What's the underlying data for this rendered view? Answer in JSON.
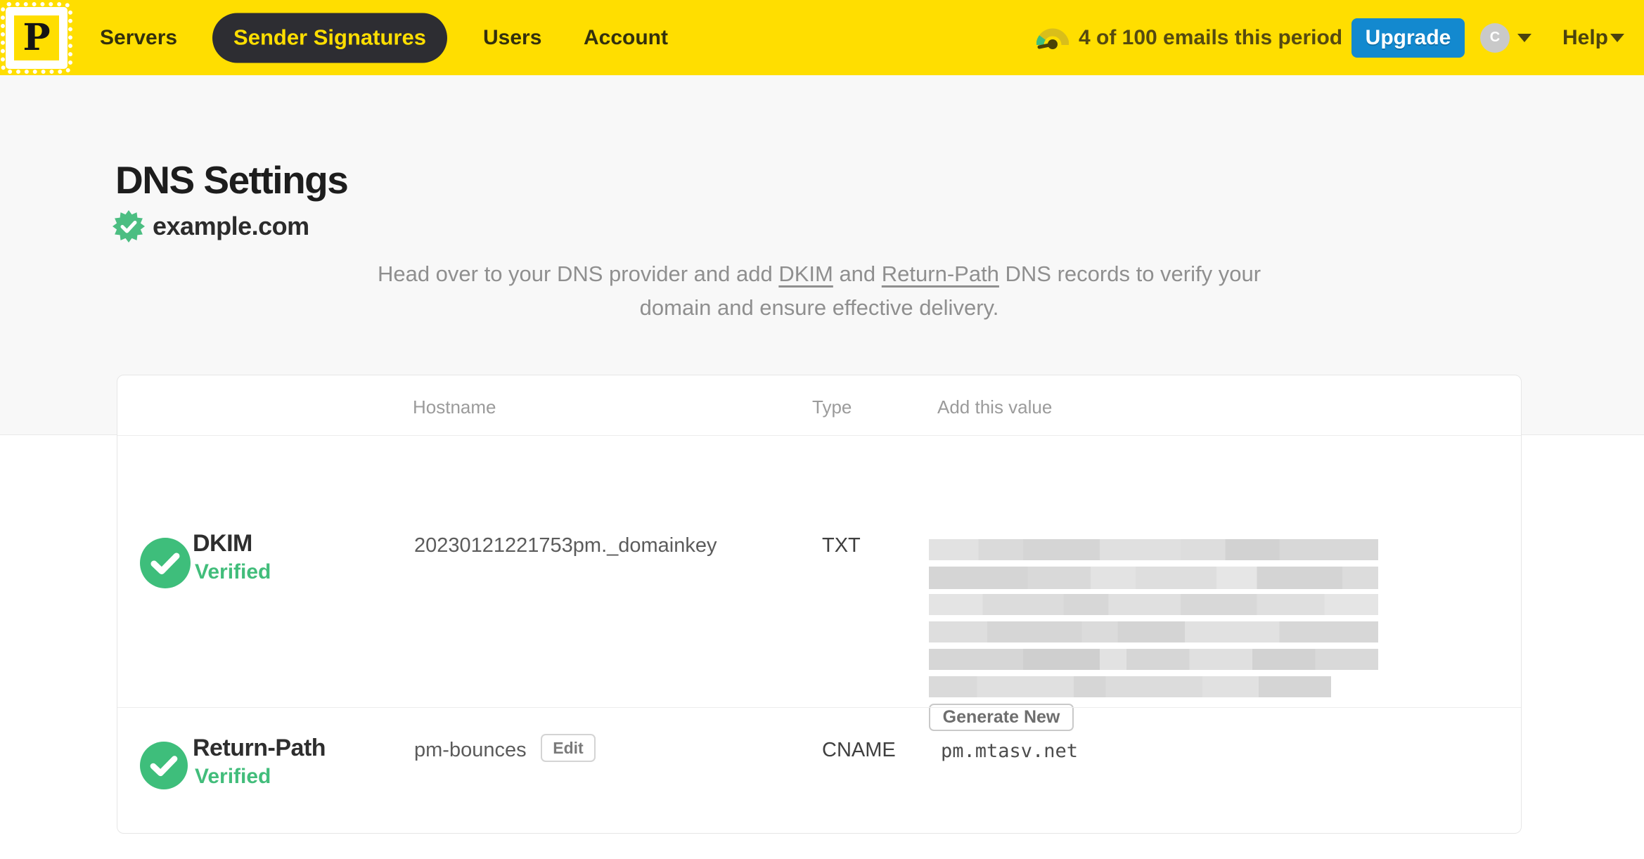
{
  "colors": {
    "brand_yellow": "#FFDE00",
    "nav_pill_dark": "#2D2D32",
    "upgrade_blue": "#1389CF",
    "verified_green": "#3EBE7B",
    "top_section_bg": "#F8F8F8"
  },
  "topbar": {
    "logo_letter": "P",
    "nav": [
      {
        "label": "Servers",
        "active": false
      },
      {
        "label": "Sender Signatures",
        "active": true
      },
      {
        "label": "Users",
        "active": false
      },
      {
        "label": "Account",
        "active": false
      }
    ],
    "usage_text": "4 of 100 emails this period",
    "upgrade_label": "Upgrade",
    "avatar_initial": "C",
    "help_label": "Help"
  },
  "page": {
    "title": "DNS Settings",
    "domain": "example.com",
    "description": {
      "prefix": "Head over to your DNS provider and add ",
      "link_dkim": "DKIM",
      "middle": " and ",
      "link_return_path": "Return-Path",
      "suffix": " DNS records to verify your domain and ensure effective delivery."
    }
  },
  "table": {
    "headers": {
      "hostname": "Hostname",
      "type": "Type",
      "value": "Add this value"
    },
    "dkim_row": {
      "name": "DKIM",
      "status": "Verified",
      "hostname": "20230121221753pm._domainkey",
      "type": "TXT",
      "value_redacted": true,
      "action_label": "Generate New"
    },
    "return_path_row": {
      "name": "Return-Path",
      "status": "Verified",
      "hostname": "pm-bounces",
      "edit_label": "Edit",
      "type": "CNAME",
      "value": "pm.mtasv.net"
    }
  },
  "icons": {
    "logo": "postage-stamp",
    "usage_gauge": "gauge-meter",
    "domain_badge": "verified-seal",
    "row_status": "check-circle",
    "dropdowns": "caret-down"
  }
}
